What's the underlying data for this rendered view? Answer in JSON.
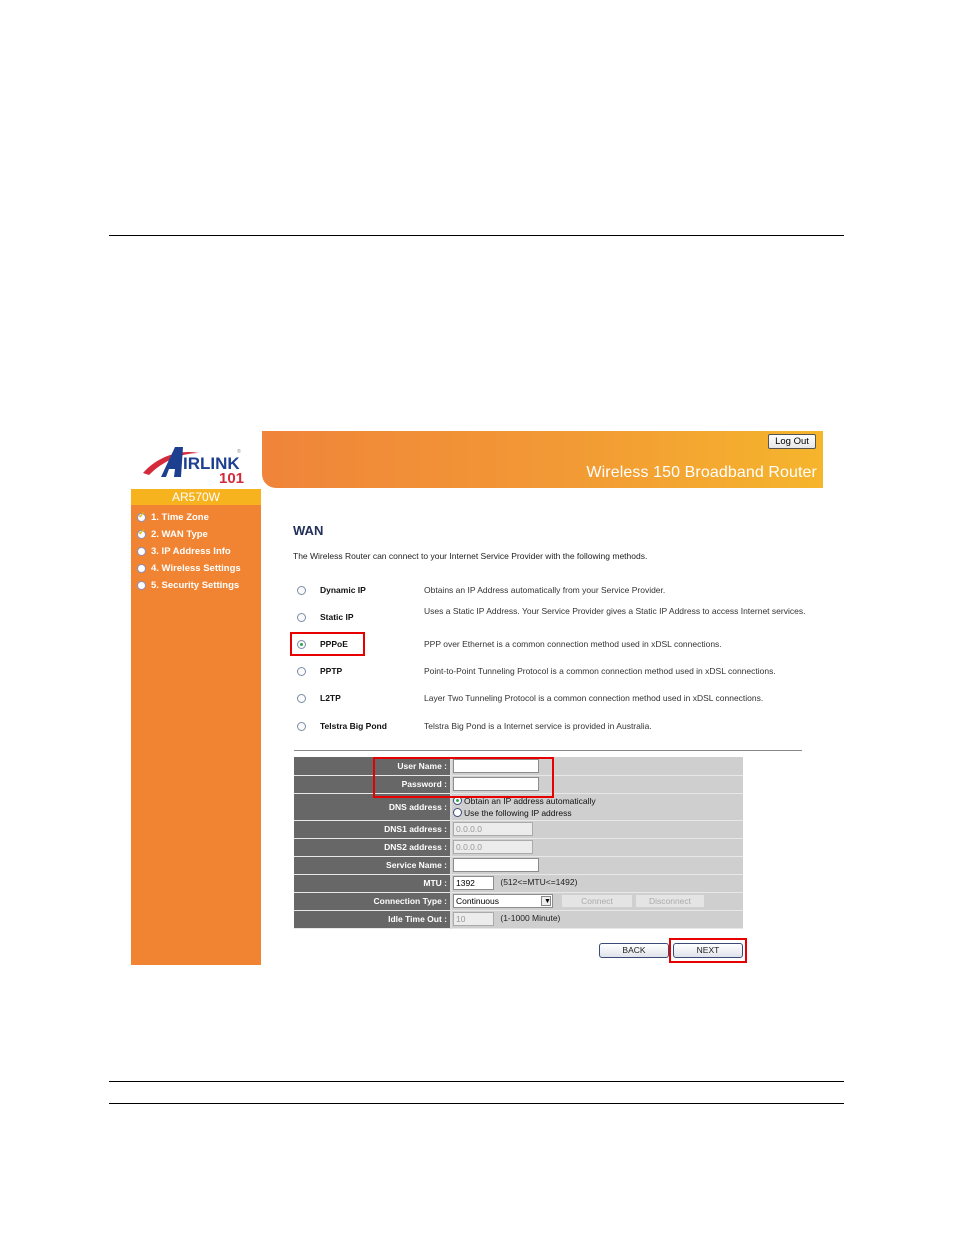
{
  "colors": {
    "sidebar": "#f08432",
    "model_bar": "#f6b31e",
    "header_start": "#f0843a",
    "header_end": "#f5b52c",
    "highlight": "#e60000",
    "label_cell": "#676767",
    "value_cell": "#cfcfcf",
    "title": "#22305a"
  },
  "brand": {
    "logo_text": "AIRLINK",
    "logo_number": "101",
    "model": "AR570W"
  },
  "header": {
    "logout_label": "Log Out",
    "product_title": "Wireless 150 Broadband Router"
  },
  "sidebar": {
    "items": [
      {
        "label": "1. Time Zone",
        "icon": "check-icon",
        "completed": true
      },
      {
        "label": "2. WAN Type",
        "icon": "check-icon",
        "completed": true
      },
      {
        "label": "3. IP Address Info",
        "icon": "bullet-icon",
        "completed": false
      },
      {
        "label": "4. Wireless Settings",
        "icon": "bullet-icon",
        "completed": false
      },
      {
        "label": "5. Security Settings",
        "icon": "bullet-icon",
        "completed": false
      }
    ]
  },
  "main": {
    "title": "WAN",
    "intro": "The Wireless Router can connect to your Internet Service Provider with the following methods.",
    "methods": [
      {
        "name": "Dynamic IP",
        "desc": "Obtains an IP Address automatically from your Service Provider.",
        "selected": false
      },
      {
        "name": "Static IP",
        "desc": "Uses a Static IP Address. Your Service Provider gives a Static IP Address to access Internet services.",
        "selected": false
      },
      {
        "name": "PPPoE",
        "desc": "PPP over Ethernet is a common connection method used in xDSL connections.",
        "selected": true
      },
      {
        "name": "PPTP",
        "desc": "Point-to-Point Tunneling Protocol is a common connection method used in xDSL connections.",
        "selected": false
      },
      {
        "name": "L2TP",
        "desc": "Layer Two Tunneling Protocol is a common connection method used in xDSL connections.",
        "selected": false
      },
      {
        "name": "Telstra Big Pond",
        "desc": "Telstra Big Pond is a Internet service is provided in Australia.",
        "selected": false
      }
    ],
    "form": {
      "user_name_label": "User Name :",
      "user_name_value": "",
      "password_label": "Password :",
      "password_value": "",
      "dns_label": "DNS address :",
      "dns_options": [
        "Obtain an IP address automatically",
        "Use the following IP address"
      ],
      "dns_selected": 0,
      "dns1_label": "DNS1 address :",
      "dns1_value": "0.0.0.0",
      "dns2_label": "DNS2 address :",
      "dns2_value": "0.0.0.0",
      "service_name_label": "Service Name :",
      "service_name_value": "",
      "mtu_label": "MTU :",
      "mtu_value": "1392",
      "mtu_note": "(512<=MTU<=1492)",
      "connection_type_label": "Connection Type :",
      "connection_type_value": "Continuous",
      "connect_label": "Connect",
      "disconnect_label": "Disconnect",
      "idle_timeout_label": "Idle Time Out :",
      "idle_timeout_value": "10",
      "idle_timeout_note": "(1-1000 Minute)"
    },
    "back_label": "BACK",
    "next_label": "NEXT"
  }
}
